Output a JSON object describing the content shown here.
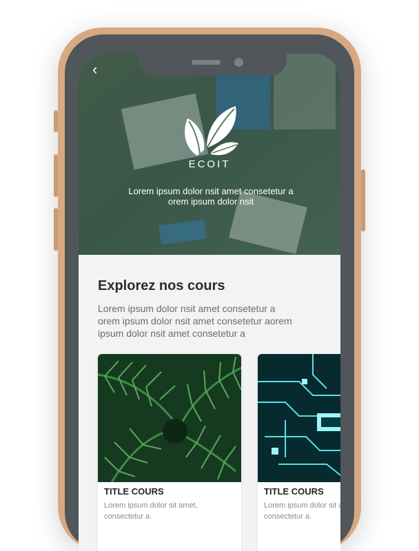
{
  "hero": {
    "back_icon": "chevron-left",
    "brand": "ECOIT",
    "subtitle": "Lorem ipsum dolor nsit amet consetetur a orem ipsum dolor nsit"
  },
  "section": {
    "title": "Explorez nos cours",
    "description": "Lorem ipsum dolor nsit amet consetetur a orem ipsum dolor nsit amet consetetur aorem ipsum dolor nsit amet consetetur a"
  },
  "cards": [
    {
      "title": "TITLE COURS",
      "description": "Lorem ipsum dolor sit amet, consectetur a.",
      "image": "fern-leaves"
    },
    {
      "title": "TITLE COURS",
      "description": "Lorem ipsum dolor sit amet, consectetur a.",
      "image": "circuit-board"
    }
  ],
  "colors": {
    "phone_frame": "#d7a982",
    "bezel": "#50565a",
    "hero_tint": "#3f5a4c",
    "background": "#f3f3f3"
  }
}
